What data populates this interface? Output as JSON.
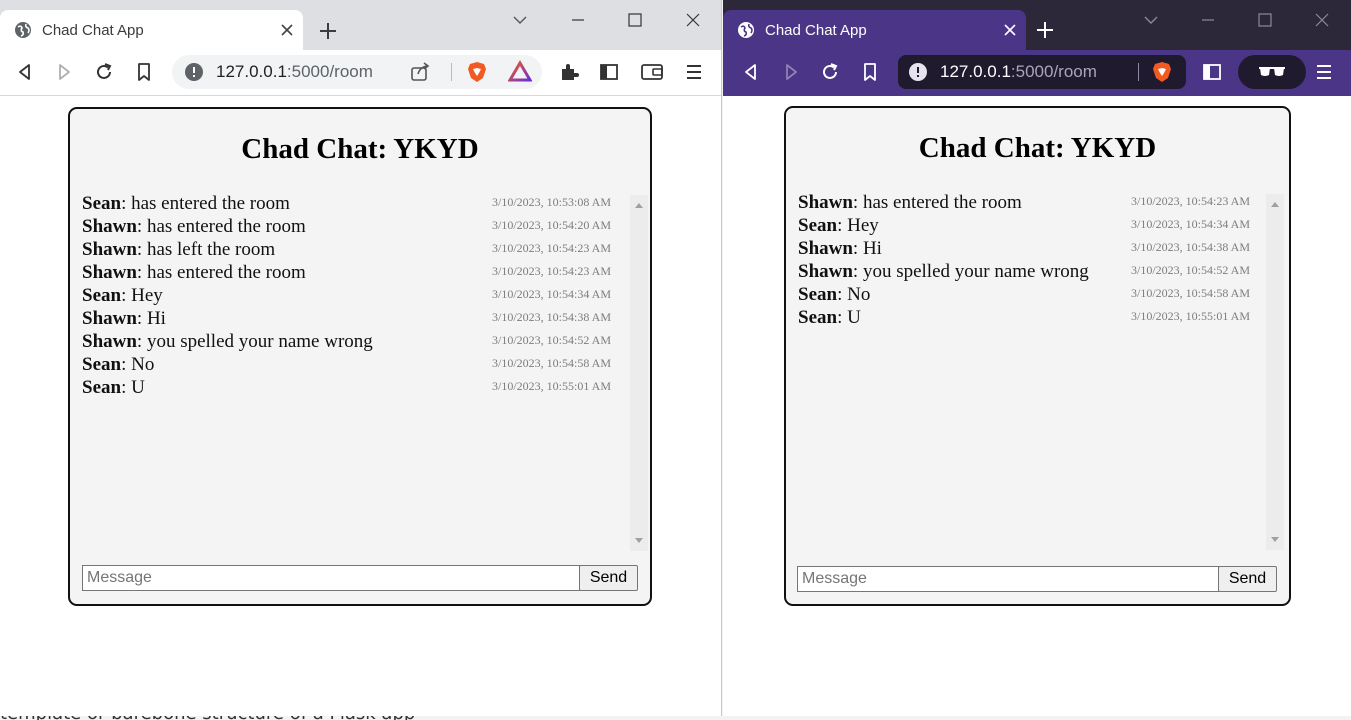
{
  "background_caption": "template or barebone structure of a Flask app",
  "windows": [
    {
      "theme": "light",
      "tab_title": "Chad Chat App",
      "url_host": "127.0.0.1",
      "url_path": ":5000/room",
      "chat_title": "Chad Chat: YKYD",
      "messages": [
        {
          "user": "Sean",
          "text": ": has entered the room",
          "time": "3/10/2023, 10:53:08 AM"
        },
        {
          "user": "Shawn",
          "text": ": has entered the room",
          "time": "3/10/2023, 10:54:20 AM"
        },
        {
          "user": "Shawn",
          "text": ": has left the room",
          "time": "3/10/2023, 10:54:23 AM"
        },
        {
          "user": "Shawn",
          "text": ": has entered the room",
          "time": "3/10/2023, 10:54:23 AM"
        },
        {
          "user": "Sean",
          "text": ": Hey",
          "time": "3/10/2023, 10:54:34 AM"
        },
        {
          "user": "Shawn",
          "text": ": Hi",
          "time": "3/10/2023, 10:54:38 AM"
        },
        {
          "user": "Shawn",
          "text": ": you spelled your name wrong",
          "time": "3/10/2023, 10:54:52 AM"
        },
        {
          "user": "Sean",
          "text": ": No",
          "time": "3/10/2023, 10:54:58 AM"
        },
        {
          "user": "Sean",
          "text": ": U",
          "time": "3/10/2023, 10:55:01 AM"
        }
      ],
      "input_placeholder": "Message",
      "send_label": "Send"
    },
    {
      "theme": "dark",
      "tab_title": "Chad Chat App",
      "url_host": "127.0.0.1",
      "url_path": ":5000/room",
      "chat_title": "Chad Chat: YKYD",
      "messages": [
        {
          "user": "Shawn",
          "text": ": has entered the room",
          "time": "3/10/2023, 10:54:23 AM"
        },
        {
          "user": "Sean",
          "text": ": Hey",
          "time": "3/10/2023, 10:54:34 AM"
        },
        {
          "user": "Shawn",
          "text": ": Hi",
          "time": "3/10/2023, 10:54:38 AM"
        },
        {
          "user": "Shawn",
          "text": ": you spelled your name wrong",
          "time": "3/10/2023, 10:54:52 AM"
        },
        {
          "user": "Sean",
          "text": ": No",
          "time": "3/10/2023, 10:54:58 AM"
        },
        {
          "user": "Sean",
          "text": ": U",
          "time": "3/10/2023, 10:55:01 AM"
        }
      ],
      "input_placeholder": "Message",
      "send_label": "Send"
    }
  ],
  "icons": {
    "tab": "globe-icon",
    "close": "close-icon",
    "new_tab": "plus-icon",
    "back": "back-icon",
    "forward": "forward-icon",
    "reload": "reload-icon",
    "bookmark": "bookmark-icon",
    "site_info": "info-icon",
    "share": "share-icon",
    "brave": "brave-shield-icon",
    "rewards": "brave-rewards-icon",
    "extensions": "puzzle-icon",
    "sidebar": "sidebar-icon",
    "wallet": "wallet-icon",
    "menu": "menu-icon",
    "private": "private-glasses-icon"
  },
  "colors": {
    "dark_titlebar": "#2d2839",
    "dark_toolbar": "#4a3587",
    "light_titlebar": "#dedfe3",
    "brave_orange": "#f15a22"
  }
}
